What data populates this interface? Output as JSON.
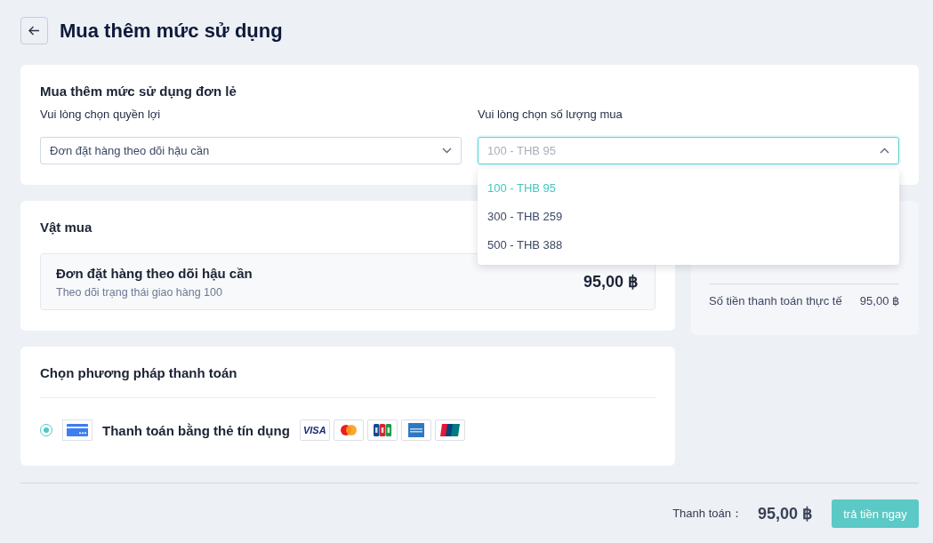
{
  "header": {
    "title": "Mua thêm mức sử dụng"
  },
  "single_purchase": {
    "title": "Mua thêm mức sử dụng đơn lẻ",
    "selects": [
      {
        "label": "Vui lòng chọn quyền lợi",
        "value": "Đơn đặt hàng theo dõi hậu cần",
        "expanded": false
      },
      {
        "label": "Vui lòng chọn số lượng mua",
        "value": "100 - THB 95",
        "expanded": true,
        "options": [
          {
            "label": "100 - THB 95",
            "selected": true
          },
          {
            "label": "300 - THB 259",
            "selected": false
          },
          {
            "label": "500 - THB 388",
            "selected": false
          }
        ]
      }
    ]
  },
  "purchase_items": {
    "title": "Vật mua",
    "items": [
      {
        "name": "Đơn đặt hàng theo dõi hậu cần",
        "description": "Theo dõi trạng thái giao hàng 100",
        "price": "95,00 ฿"
      }
    ]
  },
  "summary": {
    "rows": [
      {
        "label": "Số tiền thanh toán thực tế",
        "value": "95,00 ฿"
      }
    ]
  },
  "payment": {
    "title": "Chọn phương pháp thanh toán",
    "methods": [
      {
        "label": "Thanh toán bằng thẻ tín dụng",
        "selected": true,
        "brands": [
          {
            "kind": "visa",
            "label": "VISA"
          },
          {
            "kind": "mastercard"
          },
          {
            "kind": "jcb"
          },
          {
            "kind": "amex"
          },
          {
            "kind": "unionpay"
          }
        ]
      }
    ]
  },
  "footer": {
    "total_label": "Thanh toán：",
    "total": "95,00 ฿",
    "pay_button": "trả tiền ngay"
  }
}
